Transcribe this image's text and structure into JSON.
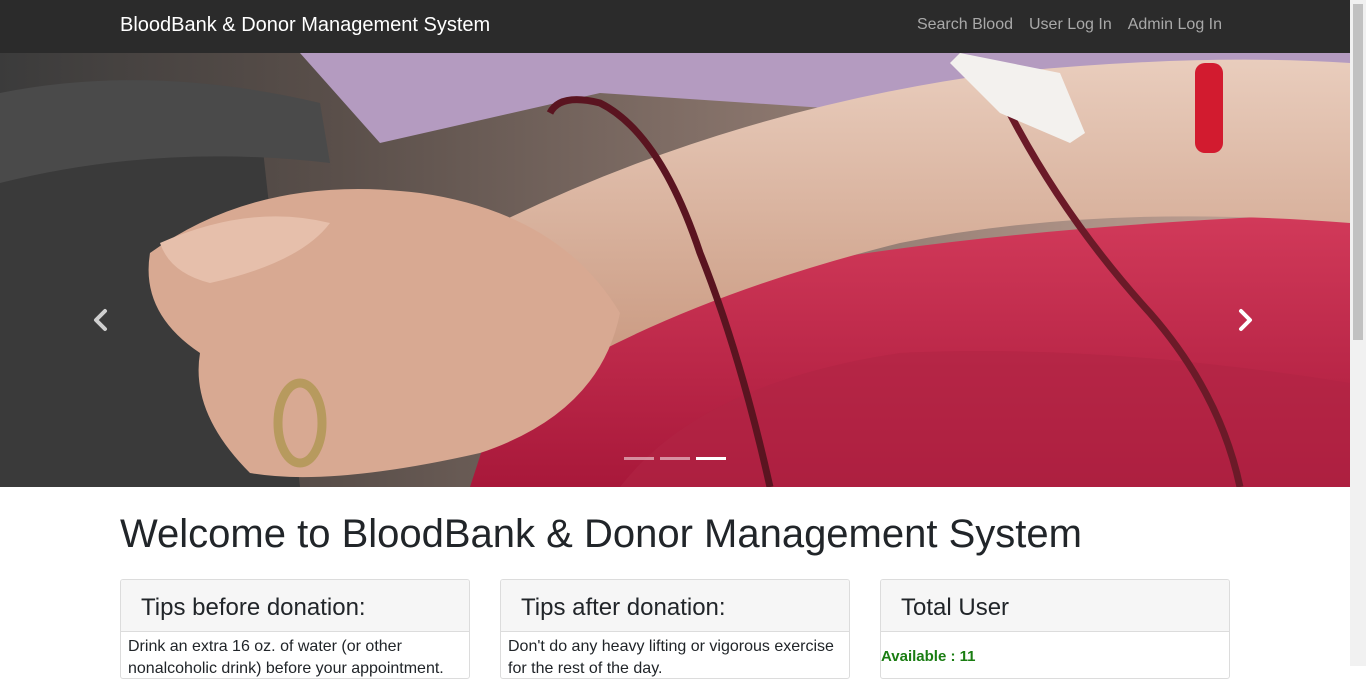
{
  "navbar": {
    "brand": "BloodBank & Donor Management System",
    "links": [
      "Search Blood",
      "User Log In",
      "Admin Log In"
    ]
  },
  "carousel": {
    "slide_count": 3,
    "active_index": 2,
    "prev_icon": "chevron-left-icon",
    "next_icon": "chevron-right-icon"
  },
  "main": {
    "welcome": "Welcome to BloodBank & Donor Management System",
    "cards": [
      {
        "title": "Tips before donation:",
        "body": "Drink an extra 16 oz. of water (or other nonalcoholic drink) before your appointment."
      },
      {
        "title": "Tips after donation:",
        "body": "Don't do any heavy lifting or vigorous exercise for the rest of the day."
      },
      {
        "title": "Total User",
        "available": "Available : 11"
      }
    ]
  },
  "colors": {
    "navbar_bg": "#2b2b2b",
    "available_text": "#1a7d12"
  }
}
